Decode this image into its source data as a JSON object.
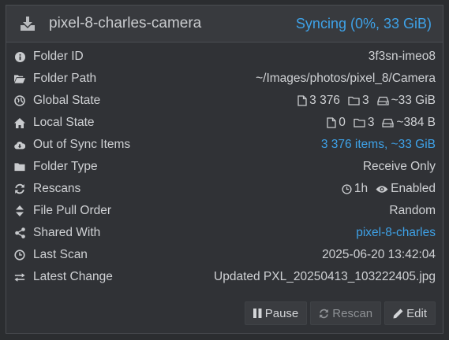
{
  "header": {
    "title": "pixel-8-charles-camera",
    "status": "Syncing (0%, 33 GiB)"
  },
  "rows": {
    "folder_id": {
      "label": "Folder ID",
      "value": "3f3sn-imeo8"
    },
    "folder_path": {
      "label": "Folder Path",
      "value": "~/Images/photos/pixel_8/Camera"
    },
    "global_state": {
      "label": "Global State",
      "files": "3 376",
      "folders": "3",
      "size": "~33 GiB"
    },
    "local_state": {
      "label": "Local State",
      "files": "0",
      "folders": "3",
      "size": "~384 B"
    },
    "out_of_sync": {
      "label": "Out of Sync Items",
      "value": "3 376 items, ~33 GiB"
    },
    "folder_type": {
      "label": "Folder Type",
      "value": "Receive Only"
    },
    "rescans": {
      "label": "Rescans",
      "interval": "1h",
      "watcher": "Enabled"
    },
    "pull_order": {
      "label": "File Pull Order",
      "value": "Random"
    },
    "shared_with": {
      "label": "Shared With",
      "value": "pixel-8-charles"
    },
    "last_scan": {
      "label": "Last Scan",
      "value": "2025-06-20 13:42:04"
    },
    "latest_change": {
      "label": "Latest Change",
      "value": "Updated PXL_20250413_103222405.jpg"
    }
  },
  "buttons": {
    "pause": "Pause",
    "rescan": "Rescan",
    "edit": "Edit"
  },
  "colors": {
    "accent": "#3ea2e8",
    "background": "#2b2d30",
    "panel": "#303236"
  }
}
